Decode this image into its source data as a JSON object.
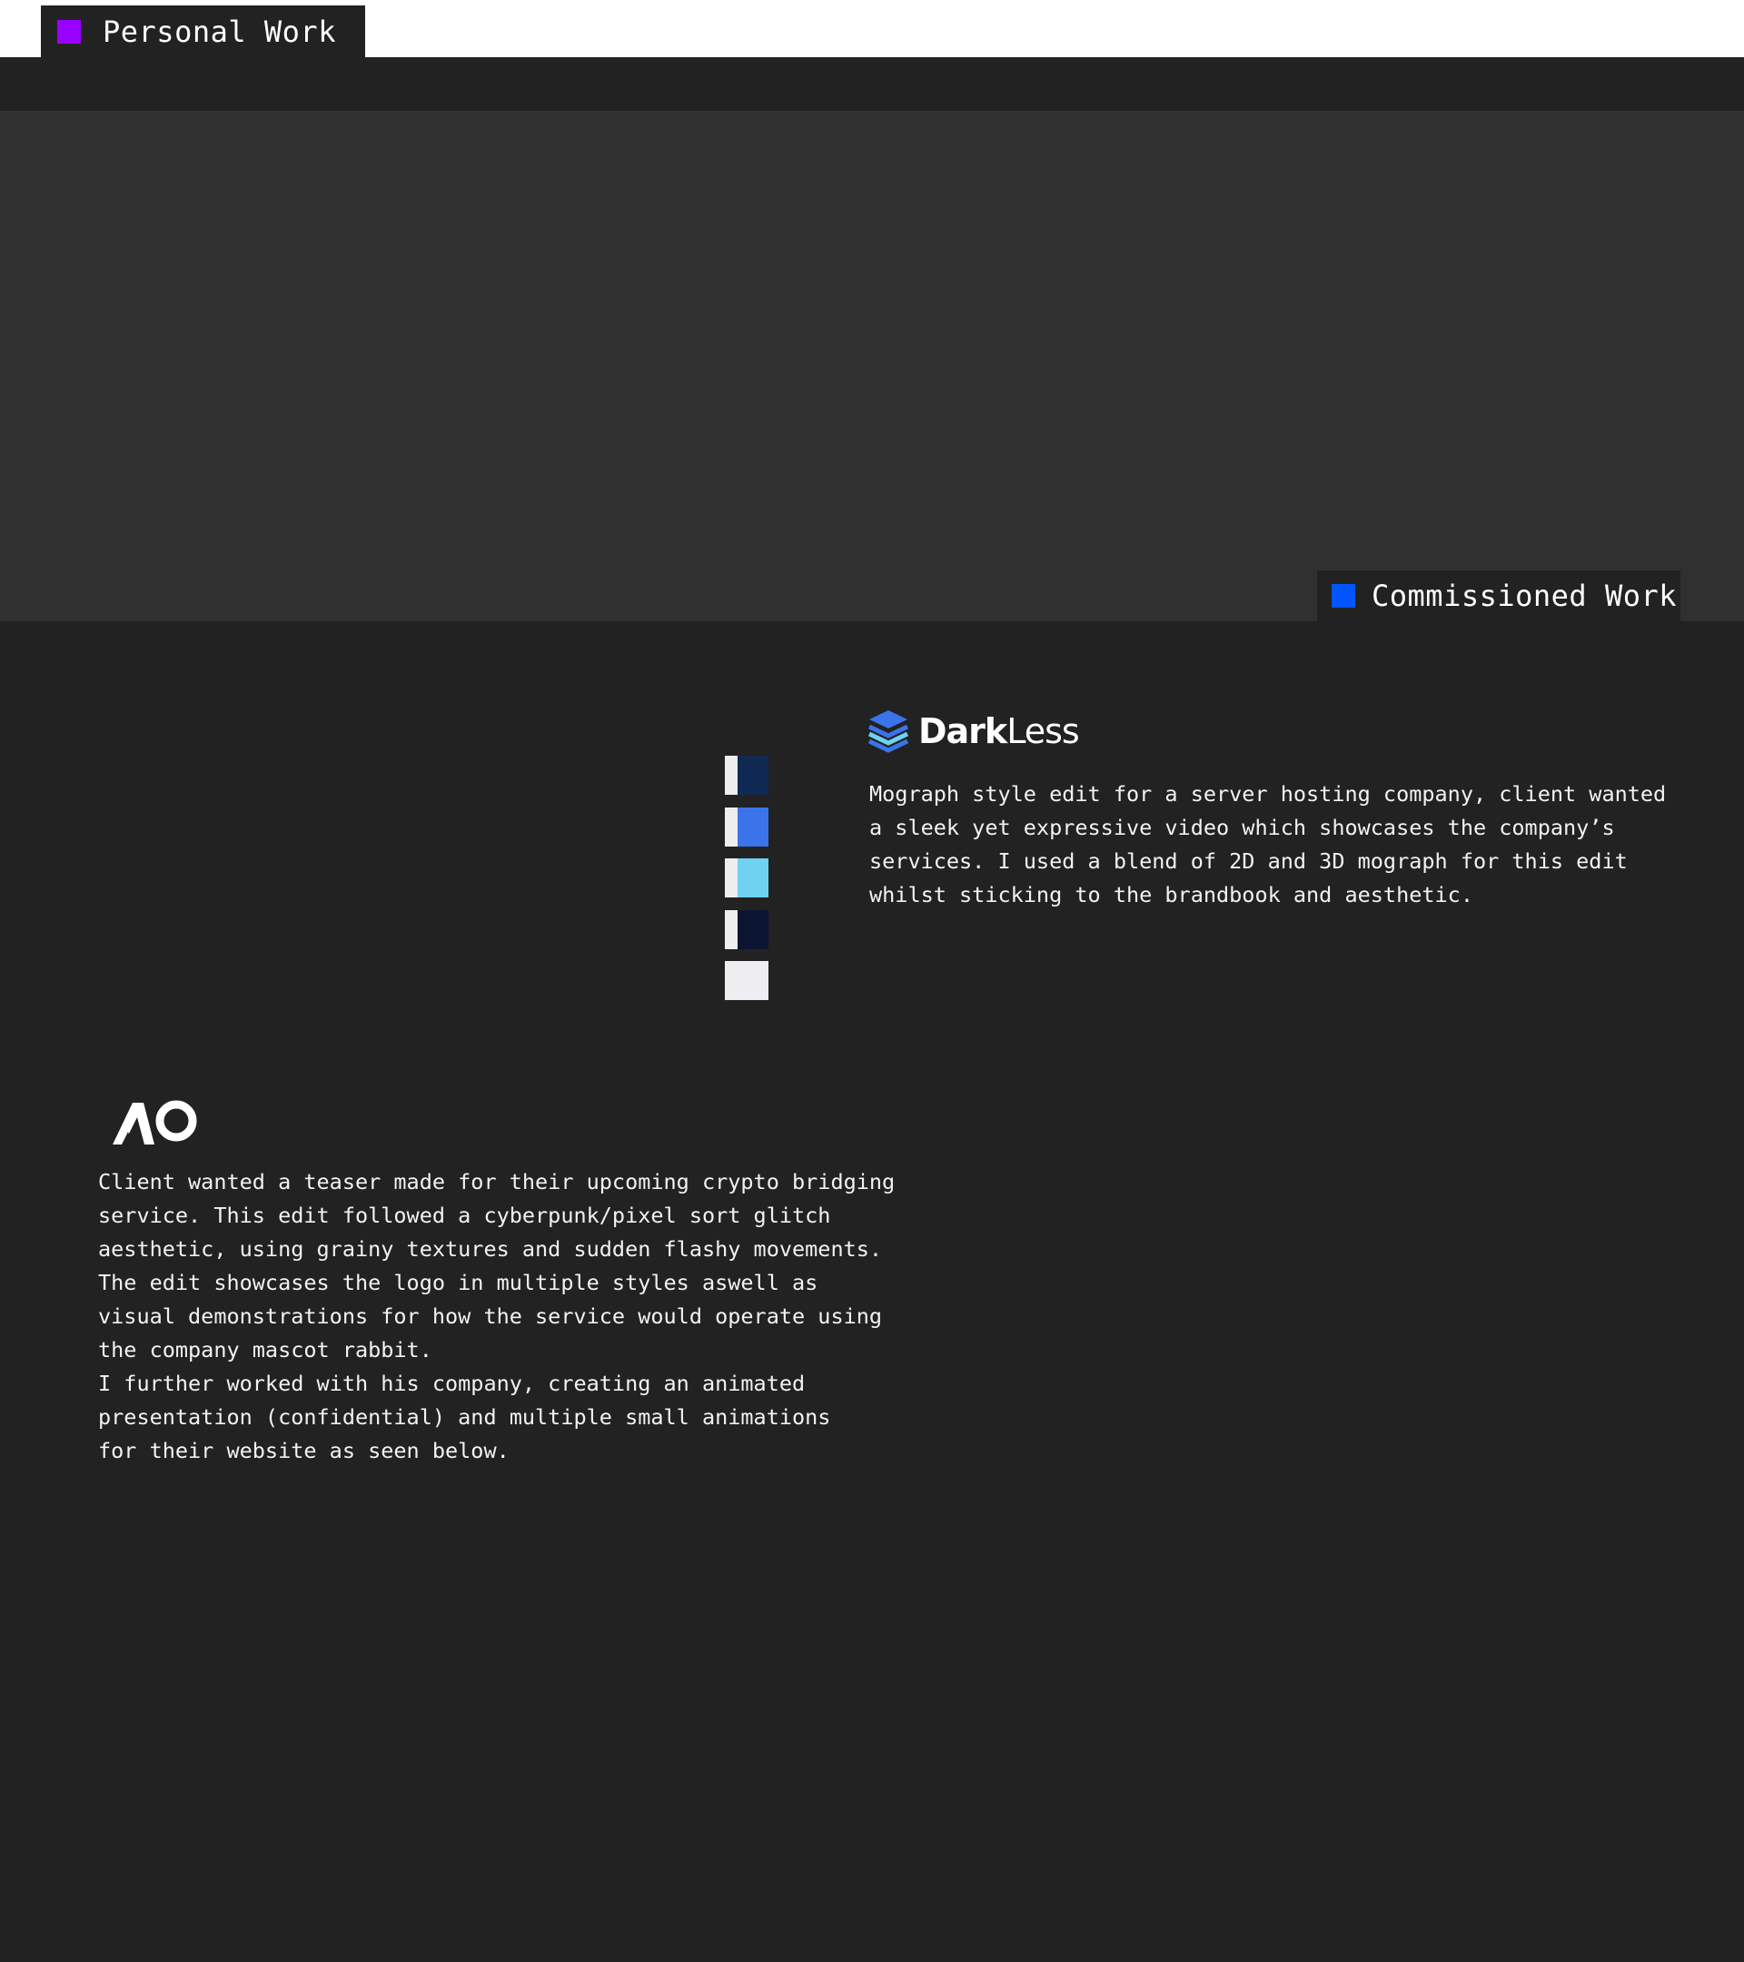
{
  "tabs": {
    "personal": {
      "label": "Personal Work",
      "swatch_color": "#9900ff"
    },
    "commissioned": {
      "label": "Commissioned Work",
      "swatch_color": "#0055ff"
    }
  },
  "darkless": {
    "brand": {
      "bold": "Dark",
      "light": "Less"
    },
    "palette": [
      "#0f2a52",
      "#3b74ea",
      "#6ed2f0",
      "#0b1430",
      "#eeeef2"
    ],
    "description": "Mograph style edit for a server hosting company, client wanted\na sleek yet expressive video which showcases the company’s\nservices. I used a blend of 2D and 3D mograph for this edit\nwhilst sticking to the brandbook and aesthetic."
  },
  "ao": {
    "description": "Client wanted a teaser made for their upcoming crypto bridging\nservice. This edit followed a cyberpunk/pixel sort glitch\naesthetic, using grainy textures and sudden flashy movements.\nThe edit showcases the logo in multiple styles aswell as\nvisual demonstrations for how the service would operate using\nthe company mascot rabbit.\nI further worked with his company, creating an animated\npresentation (confidential) and multiple small animations\nfor their website as seen below."
  }
}
